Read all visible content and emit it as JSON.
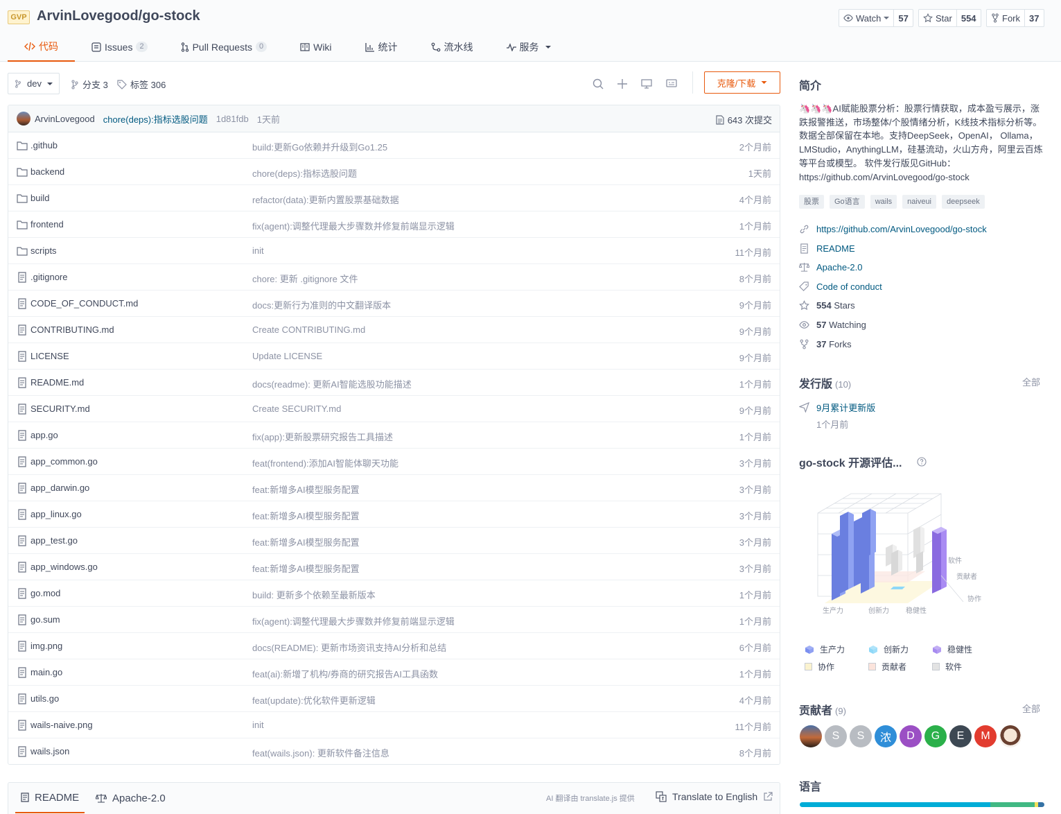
{
  "header": {
    "badge": "GVP",
    "repo_title": "ArvinLovegood/go-stock",
    "watch_label": "Watch",
    "watch_count": "57",
    "star_label": "Star",
    "star_count": "554",
    "fork_label": "Fork",
    "fork_count": "37"
  },
  "tabs": [
    {
      "label": "代码",
      "icon": "code-icon",
      "active": true
    },
    {
      "label": "Issues",
      "badge": "2",
      "icon": "issues-icon"
    },
    {
      "label": "Pull Requests",
      "badge": "0",
      "icon": "pull-request-icon"
    },
    {
      "label": "Wiki",
      "icon": "wiki-icon"
    },
    {
      "label": "统计",
      "icon": "chart-icon"
    },
    {
      "label": "流水线",
      "icon": "pipeline-icon"
    },
    {
      "label": "服务",
      "icon": "service-icon",
      "dropdown": true
    }
  ],
  "toolbar": {
    "branch": "dev",
    "branches": "分支 3",
    "tags": "标签 306",
    "clone_label": "克隆/下载"
  },
  "commit": {
    "author": "ArvinLovegood",
    "message": "chore(deps):指标选股问题",
    "hash": "1d81fdb",
    "time": "1天前",
    "count": "643 次提交"
  },
  "files": [
    {
      "name": ".github",
      "type": "folder",
      "message": "build:更新Go依赖并升级到Go1.25",
      "time": "2个月前"
    },
    {
      "name": "backend",
      "type": "folder",
      "message": "chore(deps):指标选股问题",
      "time": "1天前"
    },
    {
      "name": "build",
      "type": "folder",
      "message": "refactor(data):更新内置股票基础数据",
      "time": "4个月前"
    },
    {
      "name": "frontend",
      "type": "folder",
      "message": "fix(agent):调整代理最大步骤数并修复前端显示逻辑",
      "time": "1个月前"
    },
    {
      "name": "scripts",
      "type": "folder",
      "message": "init",
      "time": "11个月前"
    },
    {
      "name": ".gitignore",
      "type": "file",
      "message": "chore: 更新 .gitignore 文件",
      "time": "8个月前"
    },
    {
      "name": "CODE_OF_CONDUCT.md",
      "type": "file",
      "message": "docs:更新行为准则的中文翻译版本",
      "time": "9个月前"
    },
    {
      "name": "CONTRIBUTING.md",
      "type": "file",
      "message": "Create CONTRIBUTING.md",
      "time": "9个月前"
    },
    {
      "name": "LICENSE",
      "type": "file",
      "message": "Update LICENSE",
      "time": "9个月前"
    },
    {
      "name": "README.md",
      "type": "file",
      "message": "docs(readme): 更新AI智能选股功能描述",
      "time": "1个月前"
    },
    {
      "name": "SECURITY.md",
      "type": "file",
      "message": "Create SECURITY.md",
      "time": "9个月前"
    },
    {
      "name": "app.go",
      "type": "file",
      "message": "fix(app):更新股票研究报告工具描述",
      "time": "1个月前"
    },
    {
      "name": "app_common.go",
      "type": "file",
      "message": "feat(frontend):添加AI智能体聊天功能",
      "time": "3个月前"
    },
    {
      "name": "app_darwin.go",
      "type": "file",
      "message": "feat:新增多AI模型服务配置",
      "time": "3个月前"
    },
    {
      "name": "app_linux.go",
      "type": "file",
      "message": "feat:新增多AI模型服务配置",
      "time": "3个月前"
    },
    {
      "name": "app_test.go",
      "type": "file",
      "message": "feat:新增多AI模型服务配置",
      "time": "3个月前"
    },
    {
      "name": "app_windows.go",
      "type": "file",
      "message": "feat:新增多AI模型服务配置",
      "time": "3个月前"
    },
    {
      "name": "go.mod",
      "type": "file",
      "message": "build: 更新多个依赖至最新版本",
      "time": "1个月前"
    },
    {
      "name": "go.sum",
      "type": "file",
      "message": "fix(agent):调整代理最大步骤数并修复前端显示逻辑",
      "time": "1个月前"
    },
    {
      "name": "img.png",
      "type": "file",
      "message": "docs(README): 更新市场资讯支持AI分析和总结",
      "time": "6个月前"
    },
    {
      "name": "main.go",
      "type": "file",
      "message": "feat(ai):新增了机构/券商的研究报告AI工具函数",
      "time": "1个月前"
    },
    {
      "name": "utils.go",
      "type": "file",
      "message": "feat(update):优化软件更新逻辑",
      "time": "4个月前"
    },
    {
      "name": "wails-naive.png",
      "type": "file",
      "message": "init",
      "time": "11个月前"
    },
    {
      "name": "wails.json",
      "type": "file",
      "message": "feat(wails.json): 更新软件备注信息",
      "time": "8个月前"
    }
  ],
  "readme_tabs": {
    "readme": "README",
    "license": "Apache-2.0",
    "ai_note": "AI 翻译由 translate.js 提供",
    "translate": "Translate to English"
  },
  "sidebar": {
    "intro_title": "简介",
    "description": "🦄🦄🦄AI赋能股票分析：股票行情获取，成本盈亏展示，涨跌报警推送，市场整体/个股情绪分析，K线技术指标分析等。数据全部保留在本地。支持DeepSeek，OpenAI， Ollama，LMStudio，AnythingLLM，硅基流动，火山方舟，阿里云百炼等平台或模型。 软件发行版见GitHub：https://github.com/ArvinLovegood/go-stock",
    "topics": [
      "股票",
      "Go语言",
      "wails",
      "naiveui",
      "deepseek"
    ],
    "homepage": "https://github.com/ArvinLovegood/go-stock",
    "readme_link": "README",
    "license_link": "Apache-2.0",
    "conduct_link": "Code of conduct",
    "stars_num": "554",
    "stars_label": "Stars",
    "watching_num": "57",
    "watching_label": "Watching",
    "forks_num": "37",
    "forks_label": "Forks",
    "releases_title": "发行版",
    "releases_count": "(10)",
    "releases_all": "全部",
    "release_name": "9月累计更新版",
    "release_time": "1个月前",
    "eval_title": "go-stock 开源评估...",
    "contributors_title": "贡献者",
    "contributors_count": "(9)",
    "contributors_all": "全部",
    "contributors": [
      {
        "letter": "",
        "color": "#7a5a40"
      },
      {
        "letter": "S",
        "color": "#b8bcc2"
      },
      {
        "letter": "S",
        "color": "#b8bcc2"
      },
      {
        "letter": "浓",
        "color": "#2f8ed8"
      },
      {
        "letter": "D",
        "color": "#9b4fc4"
      },
      {
        "letter": "G",
        "color": "#2bb04a"
      },
      {
        "letter": "E",
        "color": "#3d4853"
      },
      {
        "letter": "M",
        "color": "#e23c2f"
      },
      {
        "letter": "",
        "color": "#f1e4d6"
      }
    ],
    "language_title": "语言"
  },
  "eval_chart": {
    "axis_labels": [
      "生产力",
      "创新力",
      "稳健性",
      "软件",
      "贡献者",
      "协作"
    ],
    "legend": [
      {
        "label": "生产力",
        "color": "#7b8ff0",
        "kind": "cube"
      },
      {
        "label": "创新力",
        "color": "#8ed8f8",
        "kind": "cube"
      },
      {
        "label": "稳健性",
        "color": "#a78bf0",
        "kind": "cube"
      },
      {
        "label": "协作",
        "color": "#fbf3cf",
        "kind": "square"
      },
      {
        "label": "贡献者",
        "color": "#fbe4dc",
        "kind": "square"
      },
      {
        "label": "软件",
        "color": "#e3e3e3",
        "kind": "square"
      }
    ]
  },
  "languages": [
    {
      "color": "#00acd7",
      "share": 78
    },
    {
      "color": "#41b883",
      "share": 18
    },
    {
      "color": "#f1e05a",
      "share": 1.5
    },
    {
      "color": "#3572a5",
      "share": 2.5
    }
  ]
}
